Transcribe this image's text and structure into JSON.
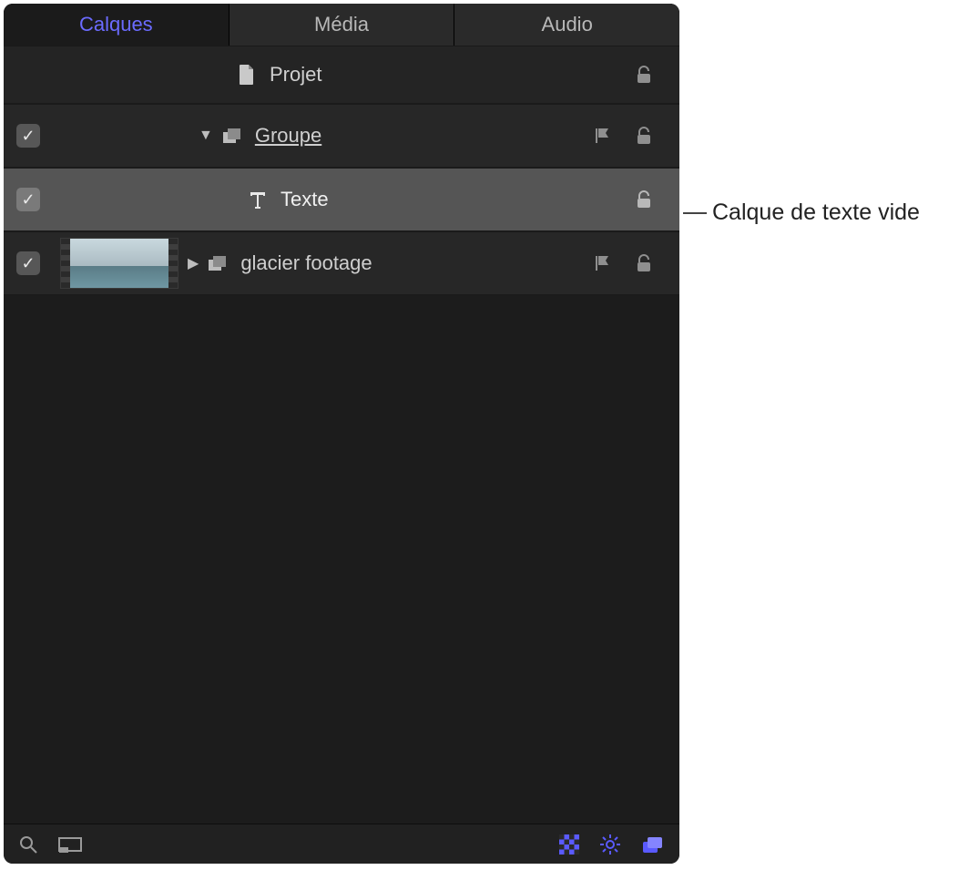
{
  "tabs": {
    "layers": "Calques",
    "media": "Média",
    "audio": "Audio"
  },
  "rows": {
    "project": "Projet",
    "group": "Groupe",
    "text": "Texte",
    "glacier": "glacier footage"
  },
  "annotation": "Calque de texte vide",
  "icons": {
    "doc": "document-icon",
    "layers": "layers-icon",
    "textT": "text-tool-icon",
    "lock": "lock-icon",
    "flag": "flag-icon",
    "search": "search-icon",
    "frame": "frame-icon",
    "checker": "checker-icon",
    "gear": "gear-icon",
    "stack": "stack-icon"
  }
}
